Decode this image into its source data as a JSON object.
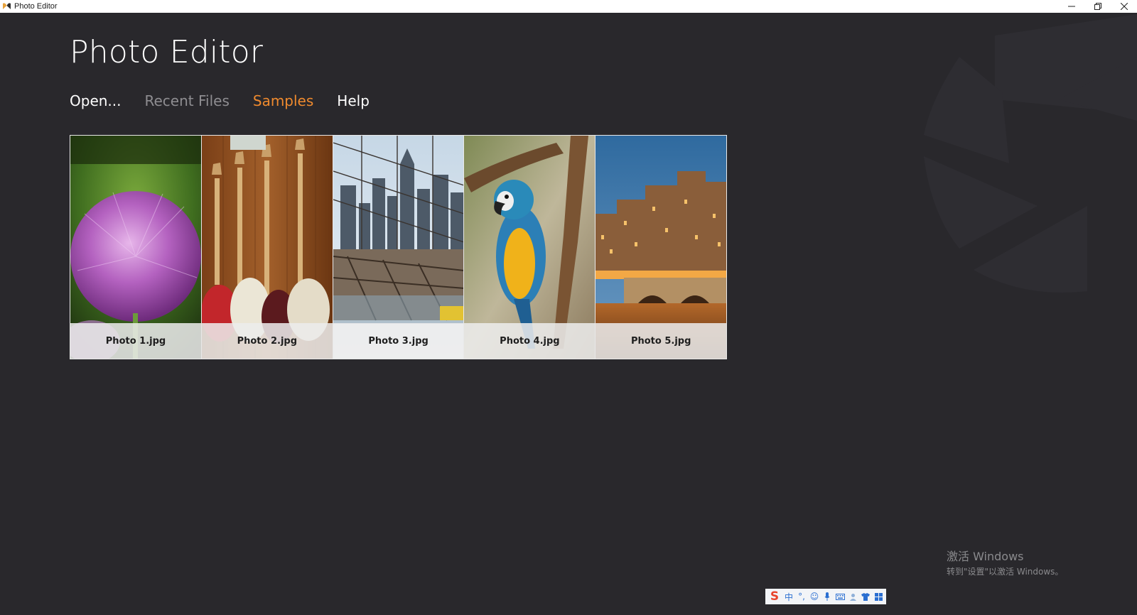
{
  "window": {
    "title": "Photo Editor"
  },
  "header": {
    "app_title": "Photo Editor"
  },
  "nav": {
    "items": [
      {
        "label": "Open...",
        "state": "normal"
      },
      {
        "label": "Recent Files",
        "state": "dimmed"
      },
      {
        "label": "Samples",
        "state": "active"
      },
      {
        "label": "Help",
        "state": "normal"
      }
    ]
  },
  "samples": [
    {
      "caption": "Photo 1.jpg",
      "subject": "purple allium flower"
    },
    {
      "caption": "Photo 2.jpg",
      "subject": "guitars on wall"
    },
    {
      "caption": "Photo 3.jpg",
      "subject": "bridge cables and city skyline"
    },
    {
      "caption": "Photo 4.jpg",
      "subject": "blue and yellow macaw"
    },
    {
      "caption": "Photo 5.jpg",
      "subject": "Paris riverside at dusk"
    }
  ],
  "activation": {
    "title": "激活 Windows",
    "subtitle": "转到\"设置\"以激活 Windows。"
  },
  "ime": {
    "logo": "S",
    "mode": "中",
    "items": [
      "punctuation-icon",
      "emoji-icon",
      "microphone-icon",
      "keyboard-icon",
      "user-icon",
      "shirt-icon",
      "grid-icon"
    ]
  },
  "colors": {
    "background": "#29282c",
    "accent": "#ef8a2e",
    "nav_dimmed": "#8e8d91",
    "text": "#ffffff"
  }
}
